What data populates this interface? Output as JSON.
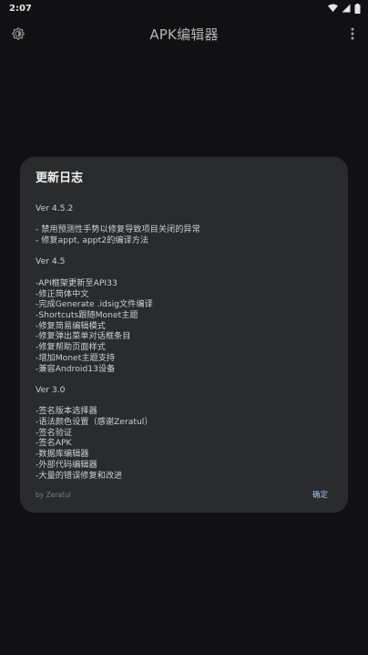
{
  "status_bar": {
    "time": "2:07",
    "icons": [
      "wifi-icon",
      "signal-icon",
      "battery-icon"
    ]
  },
  "app_bar": {
    "title": "APK编辑器",
    "left_icon": "settings-brightness-icon",
    "right_icon": "more-vert-icon"
  },
  "dialog": {
    "title": "更新日志",
    "lines": [
      "Ver 4.5.2",
      "",
      "- 禁用预测性手势以修复导致项目关闭的异常",
      "- 修复appt, appt2的编译方法",
      "",
      "Ver 4.5",
      "",
      "-API框架更新至API33",
      "-修正简体中文",
      "-完成Generate .idsig文件编译",
      "-Shortcuts跟随Monet主题",
      "-修复简易编辑模式",
      "-修复弹出菜单对话框条目",
      "-修复帮助页面样式",
      "-增加Monet主题支持",
      "-兼容Android13设备",
      "",
      "Ver 3.0",
      "",
      "-签名版本选择器",
      "-语法颜色设置（感谢Zeratul）",
      "-签名验证",
      "-签名APK",
      "-数据库编辑器",
      "-外部代码编辑器",
      "-大量的错误修复和改进"
    ],
    "author": "by Zeratul",
    "ok_label": "确定"
  },
  "colors": {
    "background": "#141416",
    "dialog": "#2a2b2d",
    "accent": "#9fc2f0"
  }
}
